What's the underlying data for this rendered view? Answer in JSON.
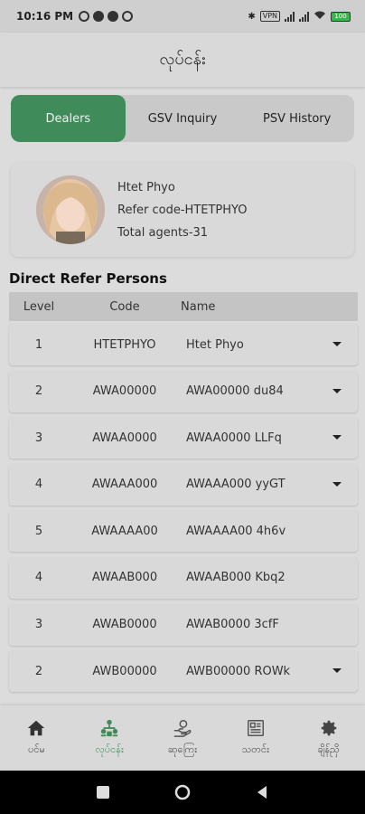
{
  "status_bar": {
    "time": "10:16 PM",
    "vpn": "VPN",
    "battery": "100"
  },
  "app_bar": {
    "title": "လုပ်ငန်း"
  },
  "tabs": [
    {
      "label": "Dealers",
      "active": true
    },
    {
      "label": "GSV Inquiry",
      "active": false
    },
    {
      "label": "PSV History",
      "active": false
    }
  ],
  "profile": {
    "name": "Htet Phyo",
    "refer_code": "Refer code-HTETPHYO",
    "total_agents": "Total agents-31"
  },
  "section_title": "Direct Refer Persons",
  "table": {
    "headers": {
      "level": "Level",
      "code": "Code",
      "name": "Name"
    },
    "rows": [
      {
        "level": "1",
        "code": "HTETPHYO",
        "name": "Htet Phyo",
        "expandable": true
      },
      {
        "level": "2",
        "code": "AWA00000",
        "name": "AWA00000 du84",
        "expandable": true
      },
      {
        "level": "3",
        "code": "AWAA0000",
        "name": "AWAA0000 LLFq",
        "expandable": true
      },
      {
        "level": "4",
        "code": "AWAAA000",
        "name": "AWAAA000 yyGT",
        "expandable": true
      },
      {
        "level": "5",
        "code": "AWAAAA00",
        "name": "AWAAAA00 4h6v",
        "expandable": false
      },
      {
        "level": "4",
        "code": "AWAAB000",
        "name": "AWAAB000 Kbq2",
        "expandable": false
      },
      {
        "level": "3",
        "code": "AWAB0000",
        "name": "AWAB0000 3cfF",
        "expandable": false
      },
      {
        "level": "2",
        "code": "AWB00000",
        "name": "AWB00000 ROWk",
        "expandable": true
      }
    ]
  },
  "bottom_nav": [
    {
      "label": "ပင်မ",
      "icon": "home-icon",
      "active": false
    },
    {
      "label": "လုပ်ငန်း",
      "icon": "network-icon",
      "active": true
    },
    {
      "label": "ဆုကြေး",
      "icon": "reward-hand-icon",
      "active": false
    },
    {
      "label": "သတင်း",
      "icon": "news-icon",
      "active": false
    },
    {
      "label": "ချိန်ညှိ",
      "icon": "gear-icon",
      "active": false
    }
  ],
  "colors": {
    "accent": "#3f8c5a"
  }
}
